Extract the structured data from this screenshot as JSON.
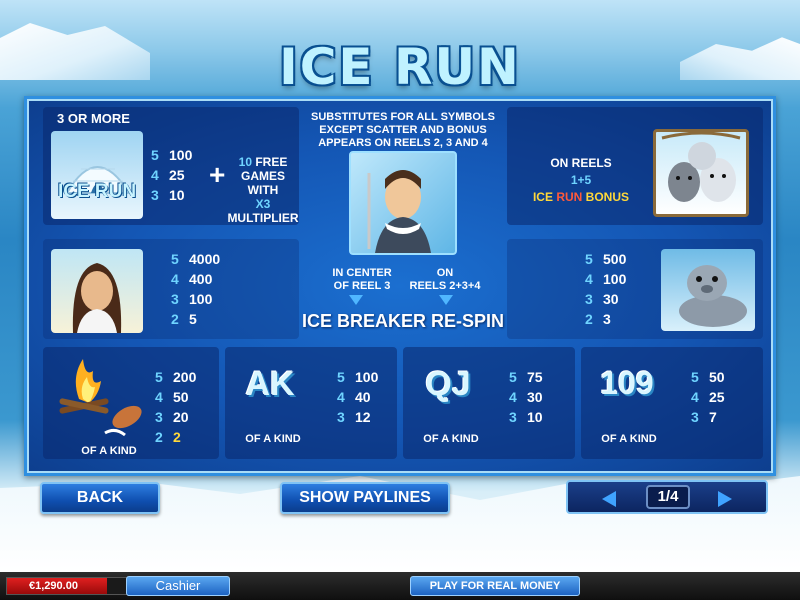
{
  "game": {
    "logo": "ICE RUN"
  },
  "scatter": {
    "heading": "3 OR MORE",
    "symbol_text": "ICE RUN",
    "pays": [
      {
        "n": "5",
        "v": "100"
      },
      {
        "n": "4",
        "v": "25"
      },
      {
        "n": "3",
        "v": "10"
      }
    ],
    "plus": "+",
    "free_count": "10",
    "free_line1": "FREE",
    "free_line2": "GAMES WITH",
    "mult": "X3",
    "free_line3": "MULTIPLIER"
  },
  "wild": {
    "line1": "SUBSTITUTES FOR ALL SYMBOLS",
    "line2": "EXCEPT SCATTER AND BONUS",
    "line3": "APPEARS ON REELS 2, 3 AND 4",
    "left_label_1": "IN CENTER",
    "left_label_2": "OF REEL 3",
    "right_label_1": "ON",
    "right_label_2": "REELS 2+3+4",
    "feature": "ICE BREAKER RE-SPIN"
  },
  "bonus": {
    "line1": "ON REELS",
    "reels": "1+5",
    "name_ice": "ICE",
    "name_run": "RUN",
    "name_bonus": "BONUS"
  },
  "girl": {
    "pays": [
      {
        "n": "5",
        "v": "4000"
      },
      {
        "n": "4",
        "v": "400"
      },
      {
        "n": "3",
        "v": "100"
      },
      {
        "n": "2",
        "v": "5"
      }
    ]
  },
  "seal": {
    "pays": [
      {
        "n": "5",
        "v": "500"
      },
      {
        "n": "4",
        "v": "100"
      },
      {
        "n": "3",
        "v": "30"
      },
      {
        "n": "2",
        "v": "3"
      }
    ]
  },
  "campfire": {
    "pays": [
      {
        "n": "5",
        "v": "200"
      },
      {
        "n": "4",
        "v": "50"
      },
      {
        "n": "3",
        "v": "20"
      },
      {
        "n": "2",
        "v": "2"
      }
    ],
    "caption": "OF A KIND"
  },
  "ak": {
    "symbol": "AK",
    "pays": [
      {
        "n": "5",
        "v": "100"
      },
      {
        "n": "4",
        "v": "40"
      },
      {
        "n": "3",
        "v": "12"
      }
    ],
    "caption": "OF A KIND"
  },
  "qj": {
    "symbol": "QJ",
    "pays": [
      {
        "n": "5",
        "v": "75"
      },
      {
        "n": "4",
        "v": "30"
      },
      {
        "n": "3",
        "v": "10"
      }
    ],
    "caption": "OF A KIND"
  },
  "ten9": {
    "symbol": "109",
    "pays": [
      {
        "n": "5",
        "v": "50"
      },
      {
        "n": "4",
        "v": "25"
      },
      {
        "n": "3",
        "v": "7"
      }
    ],
    "caption": "OF A KIND"
  },
  "controls": {
    "back": "BACK",
    "show_paylines": "SHOW PAYLINES",
    "page": "1/4"
  },
  "bottombar": {
    "balance": "€1,290.00",
    "cashier": "Cashier",
    "real_money": "PLAY FOR REAL MONEY"
  },
  "colors": {
    "accent_cyan": "#6fd4ff",
    "accent_yellow": "#ffd83a",
    "panel_blue": "#1456b4"
  }
}
